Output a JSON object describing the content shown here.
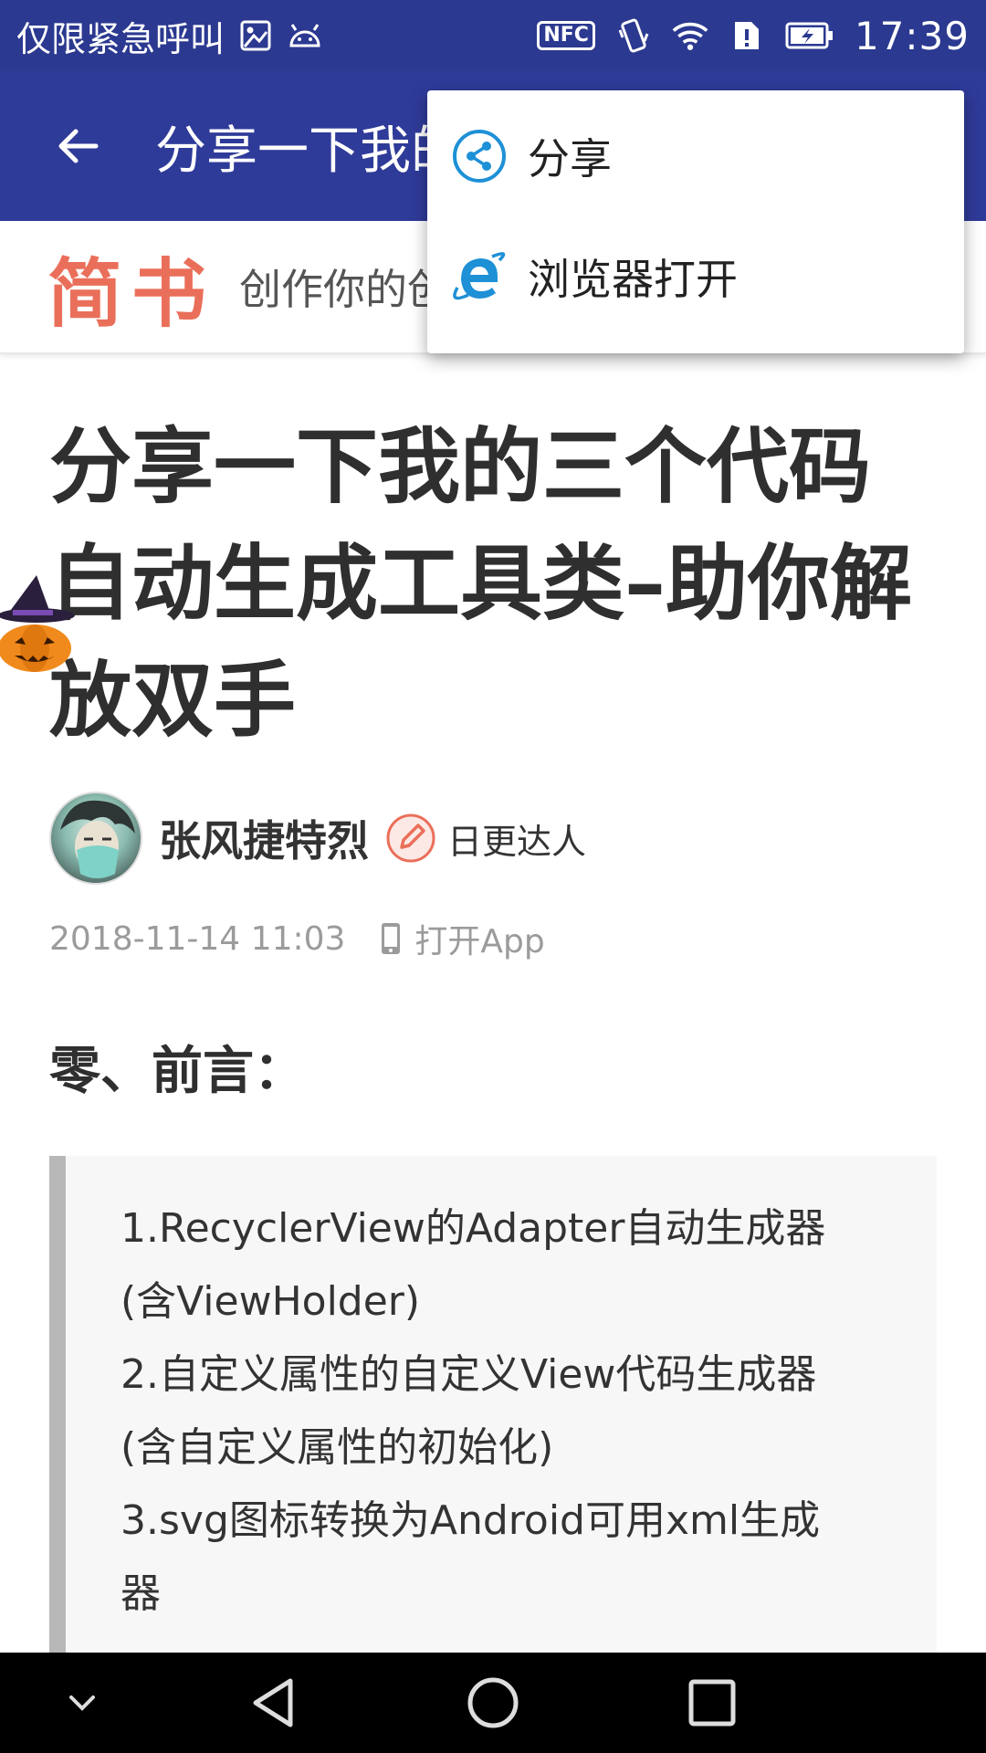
{
  "status_bar": {
    "carrier_text": "仅限紧急呼叫",
    "nfc_label": "NFC",
    "time": "17:39"
  },
  "toolbar": {
    "title": "分享一下我的三个代码自动生成工具类–助你解放双手"
  },
  "brand": {
    "logo": "简书",
    "slogan": "创作你的创作"
  },
  "popup_menu": {
    "items": [
      {
        "label": "分享",
        "icon": "share-icon"
      },
      {
        "label": "浏览器打开",
        "icon": "browser-icon"
      }
    ]
  },
  "article": {
    "title": "分享一下我的三个代码自动生成工具类–助你解放双手",
    "author": "张风捷特烈",
    "badge": "日更达人",
    "date": "2018-11-14 11:03",
    "open_app": "打开App",
    "section_heading": "零、前言：",
    "quote_lines": [
      "1.RecyclerView的Adapter自动生成器",
      "(含ViewHolder)",
      "2.自定义属性的自定义View代码生成器",
      "(含自定义属性的初始化)",
      "3.svg图标转换为Android可用xml生成",
      "器"
    ]
  },
  "colors": {
    "status_bar": "#2b3990",
    "toolbar": "#2f3b99",
    "brand_accent": "#ea6f5a",
    "quote_bar": "#b8b8b8"
  }
}
